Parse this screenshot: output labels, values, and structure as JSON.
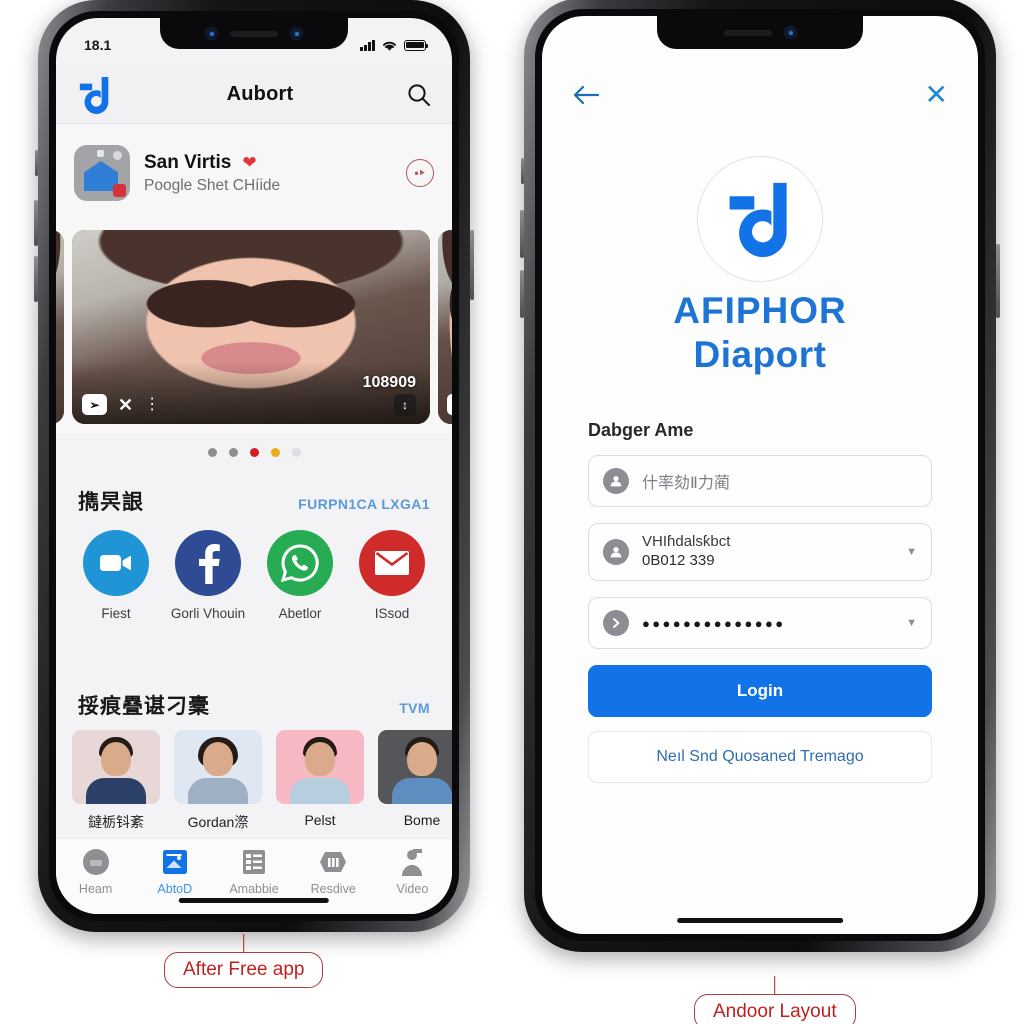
{
  "left_phone": {
    "status_bar": {
      "time": "18.1",
      "signal_icon": "cellular-bars-icon",
      "wifi_icon": "wifi-icon",
      "battery_icon": "battery-icon"
    },
    "app_bar": {
      "logo_icon": "brand-d-logo-icon",
      "title": "Aubort",
      "search_icon": "search-icon"
    },
    "list_item": {
      "thumb_icon": "house-thumbnail-icon",
      "title": "San Virtis",
      "favorite_icon": "heart-icon",
      "subtitle": "Poogle Shet CHíide",
      "action_icon": "more-circle-icon"
    },
    "carousel": {
      "overlay": {
        "pin_icon": "pin-button-icon",
        "shuffle_icon": "shuffle-icon",
        "menu_icon": "kebab-menu-icon",
        "count": "108909",
        "expand_icon": "expand-icon",
        "next_card_icon": "close-small-icon"
      },
      "dots": [
        {
          "color": "#8d8f93"
        },
        {
          "color": "#8d8f93"
        },
        {
          "color": "#d41f1f"
        },
        {
          "color": "#f0ab1c"
        },
        {
          "color": "#dedfe2"
        }
      ]
    },
    "apps_section": {
      "title": "擕昗詪",
      "link": "FURPN1CA LXGA1",
      "items": [
        {
          "label": "Fiest",
          "icon": "video-camera-icon",
          "color": "#2095d6"
        },
        {
          "label": "Gorli Vhouin",
          "icon": "facebook-icon",
          "color": "#2e4b93"
        },
        {
          "label": "Abetlor",
          "icon": "whatsapp-icon",
          "color": "#28ac53"
        },
        {
          "label": "ISsod",
          "icon": "envelope-mail-icon",
          "color": "#cf2b2b"
        }
      ]
    },
    "contacts_section": {
      "title": "挼痕疂谌刁橐",
      "link": "TVM",
      "items": [
        {
          "name": "鐽栃钭紊",
          "bg": "#e7d7d7",
          "shirt": "#2c3f66"
        },
        {
          "name": "Gordan漈",
          "bg": "#dfe7f2",
          "shirt": "#9fb0c4"
        },
        {
          "name": "Pelst",
          "bg": "#f6b9c4",
          "shirt": "#b6cede"
        },
        {
          "name": "Bome",
          "bg": "#55565a",
          "shirt": "#5e8ec0"
        }
      ]
    },
    "tab_bar": {
      "items": [
        {
          "label": "Heam",
          "icon": "home-circle-icon",
          "active": false
        },
        {
          "label": "AbtoD",
          "icon": "chart-card-icon",
          "active": true
        },
        {
          "label": "Amabbie",
          "icon": "list-grid-icon",
          "active": false
        },
        {
          "label": "Resdive",
          "icon": "archive-icon",
          "active": false
        },
        {
          "label": "Video",
          "icon": "video-person-icon",
          "active": false
        }
      ]
    }
  },
  "right_phone": {
    "top_bar": {
      "back_icon": "back-arrow-icon",
      "close_icon": "close-x-icon"
    },
    "logo": {
      "icon": "brand-d-logo-icon"
    },
    "brand": {
      "line1": "AFIPHOR",
      "line2": "Diaport"
    },
    "form": {
      "label": "Dabger Ame",
      "username_field": {
        "icon": "user-avatar-icon",
        "placeholder": "什率劾Ⅱ力蔺"
      },
      "account_field": {
        "icon": "user-avatar-icon",
        "value_line1": "VHIɦdalsƙbct",
        "value_line2": "0B012 339",
        "caret_icon": "chevron-down-icon"
      },
      "password_field": {
        "icon": "chevron-right-circle-icon",
        "value": "●●●●●●●●●●●●●●",
        "caret_icon": "chevron-down-icon"
      },
      "login_button": "Login",
      "alt_button": "Neıl Snd Quosaned Tremago"
    }
  },
  "callouts": {
    "left": "After Free app",
    "right": "Andoor Layout"
  },
  "colors": {
    "accent_blue": "#1272e8",
    "link_blue": "#2f6cb0",
    "callout_red": "#c02020"
  }
}
